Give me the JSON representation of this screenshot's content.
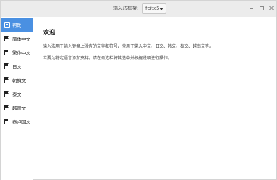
{
  "header": {
    "framework_label": "输入法框架:",
    "framework_value": "fcitx5"
  },
  "sidebar": {
    "items": [
      {
        "label": "帮助",
        "icon": "document-icon",
        "active": true
      },
      {
        "label": "简体中文",
        "icon": "flag-icon"
      },
      {
        "label": "繁体中文",
        "icon": "flag-icon"
      },
      {
        "label": "日文",
        "icon": "flag-icon"
      },
      {
        "label": "朝鲜文",
        "icon": "flag-icon"
      },
      {
        "label": "泰文",
        "icon": "flag-icon"
      },
      {
        "label": "越南文",
        "icon": "flag-icon"
      },
      {
        "label": "泰卢固文",
        "icon": "flag-icon"
      }
    ]
  },
  "main": {
    "title": "欢迎",
    "paragraph1": "输入法用于输入键盘上没有的文字和符号，常用于输入中文、日文、韩文、泰文、越南文等。",
    "paragraph2": "若要为特定语言添加支持，请在侧边栏将其选中并根据说明进行操作。"
  },
  "colors": {
    "accent": "#4a90e2"
  }
}
